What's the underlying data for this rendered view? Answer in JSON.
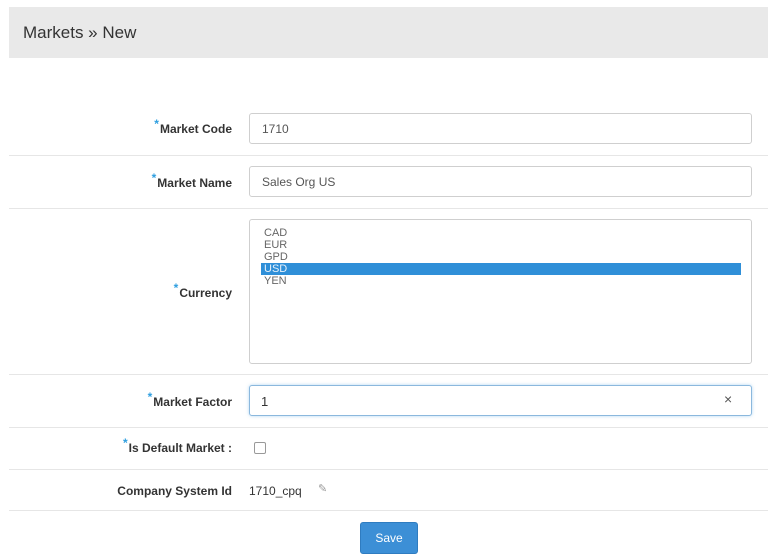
{
  "header": {
    "title": "Markets » New"
  },
  "form": {
    "market_code": {
      "label": "Market Code",
      "value": "1710"
    },
    "market_name": {
      "label": "Market Name",
      "value": "Sales Org US"
    },
    "currency": {
      "label": "Currency",
      "options": [
        "CAD",
        "EUR",
        "GPD",
        "USD",
        "YEN"
      ],
      "selected": "USD"
    },
    "market_factor": {
      "label": "Market Factor",
      "value": "1",
      "clear_icon": "×"
    },
    "is_default_market": {
      "label": "Is Default Market :",
      "checked": false
    },
    "company_system_id": {
      "label": "Company System Id",
      "value": "1710_cpq"
    },
    "required_marker": "*"
  },
  "actions": {
    "save_label": "Save"
  },
  "colors": {
    "accent": "#3c8fd6",
    "required": "#2f9fe0",
    "header_bg": "#e9e9e9"
  }
}
